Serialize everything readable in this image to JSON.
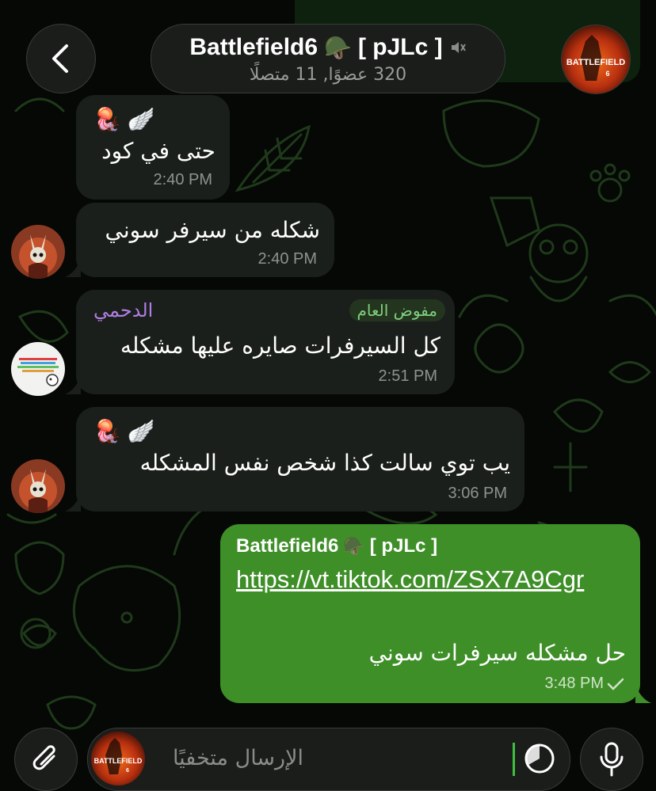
{
  "header": {
    "group_name": "Battlefield6",
    "group_emoji": "🪖",
    "group_tag": "[ pJLc ]",
    "subtitle": "320 عضوًا, 11 متصلًا",
    "avatar_text_line1": "BATTLEFIELD",
    "avatar_text_line2": "6"
  },
  "messages": [
    {
      "text": "حتى في كود",
      "time": "2:40 PM",
      "reactions": [
        "🪼",
        "🪽"
      ]
    },
    {
      "text": "شكله من سيرفر سوني",
      "time": "2:40 PM"
    },
    {
      "sender": "الدحمي",
      "role": "مفوض العام",
      "text": "كل السيرفرات صايره عليها مشكله",
      "time": "2:51 PM"
    },
    {
      "text": "يب توي سالت كذا شخص نفس المشكله",
      "time": "3:06 PM",
      "reactions": [
        "🪼",
        "🪽"
      ]
    },
    {
      "forward_name": "Battlefield6",
      "forward_emoji": "🪖",
      "forward_tag": "[ pJLc ]",
      "link": "https://vt.tiktok.com/ZSX7A9Cgr",
      "text": "حل مشكله سيرفرات سوني",
      "time": "3:48 PM",
      "status": "sent"
    }
  ],
  "input": {
    "placeholder": "الإرسال متخفيًا",
    "avatar_text_line1": "BATTLEFIELD",
    "avatar_text_line2": "6"
  },
  "colors": {
    "outgoing_bubble": "#3f8f29",
    "incoming_bubble": "#1b1f1b",
    "sender_name": "#b07ee6",
    "role_badge": "#7fcf7f",
    "background": "#050805"
  }
}
